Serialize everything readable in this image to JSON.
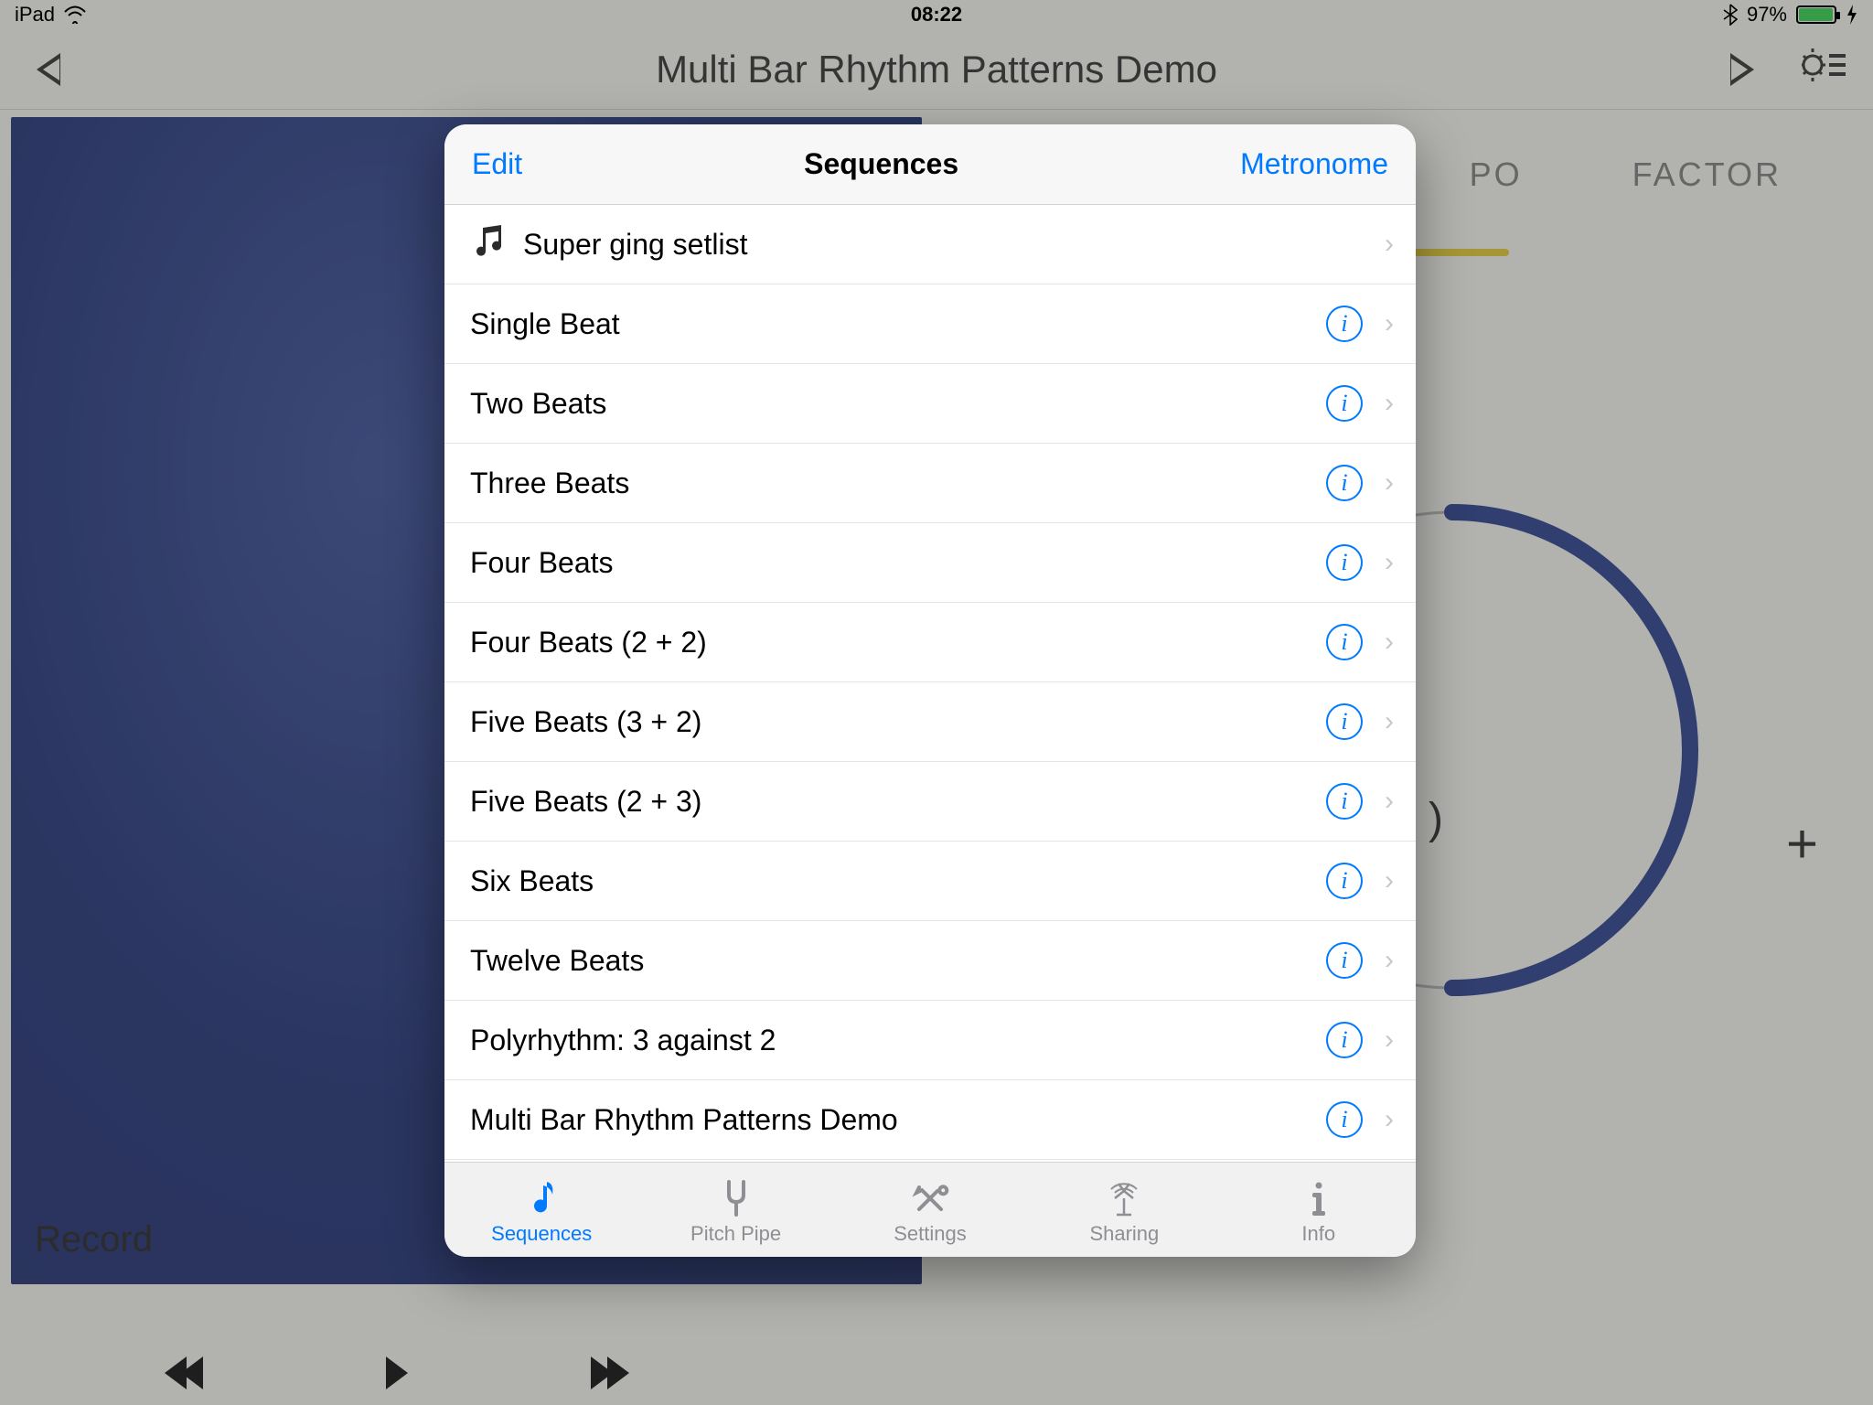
{
  "status_bar": {
    "device": "iPad",
    "time": "08:22",
    "battery_pct": "97%"
  },
  "app_header": {
    "title": "Multi Bar Rhythm Patterns Demo"
  },
  "bg_tabs": {
    "tab_tempo_fragment": "PO",
    "tab_factor": "FACTOR"
  },
  "blue_panel": {
    "record_label": "Record"
  },
  "dial": {
    "zero_fragment": ")",
    "plus": "+"
  },
  "popover": {
    "header": {
      "edit": "Edit",
      "title": "Sequences",
      "metronome": "Metronome"
    },
    "setlist": {
      "label": "Super ging setlist"
    },
    "items": [
      {
        "label": "Single Beat"
      },
      {
        "label": "Two Beats"
      },
      {
        "label": "Three Beats"
      },
      {
        "label": "Four Beats"
      },
      {
        "label": "Four Beats (2 + 2)"
      },
      {
        "label": "Five Beats (3 + 2)"
      },
      {
        "label": "Five Beats (2 + 3)"
      },
      {
        "label": "Six Beats"
      },
      {
        "label": "Twelve Beats"
      },
      {
        "label": "Polyrhythm: 3 against 2"
      },
      {
        "label": "Multi Bar Rhythm Patterns Demo"
      }
    ],
    "tabbar": [
      {
        "label": "Sequences"
      },
      {
        "label": "Pitch Pipe"
      },
      {
        "label": "Settings"
      },
      {
        "label": "Sharing"
      },
      {
        "label": "Info"
      }
    ]
  }
}
